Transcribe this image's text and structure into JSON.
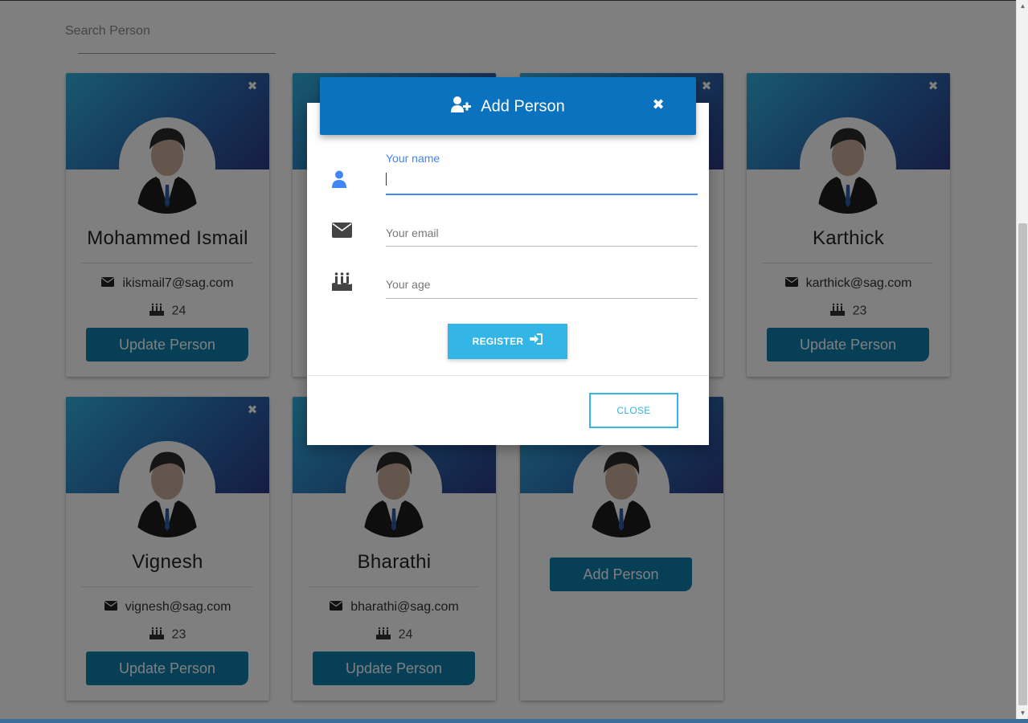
{
  "search": {
    "placeholder": "Search Person"
  },
  "cards": [
    {
      "name": "Mohammed Ismail",
      "email": "ikismail7@sag.com",
      "age": "24",
      "button": "Update Person"
    },
    {
      "name": "",
      "email": "",
      "age": "",
      "button": ""
    },
    {
      "name": "",
      "email": "",
      "age": "",
      "button": ""
    },
    {
      "name": "Karthick",
      "email": "karthick@sag.com",
      "age": "23",
      "button": "Update Person"
    },
    {
      "name": "Vignesh",
      "email": "vignesh@sag.com",
      "age": "23",
      "button": "Update Person"
    },
    {
      "name": "Bharathi",
      "email": "bharathi@sag.com",
      "age": "24",
      "button": "Update Person"
    }
  ],
  "add_card": {
    "button": "Add Person"
  },
  "modal": {
    "title": "Add Person",
    "name_label": "Your name",
    "name_value": "",
    "email_placeholder": "Your email",
    "age_placeholder": "Your age",
    "register_label": "REGISTER",
    "close_label": "CLOSE"
  },
  "icons": {
    "card_close": "close-icon",
    "email": "envelope-icon",
    "age": "birthday-cake-icon",
    "modal_title": "user-plus-icon",
    "name_field": "user-icon",
    "register": "sign-in-icon"
  },
  "colors": {
    "modal_header": "#0a72bf",
    "card_button": "#0e7fae",
    "register_button": "#33b5e5",
    "focus_blue": "#4285f4"
  }
}
